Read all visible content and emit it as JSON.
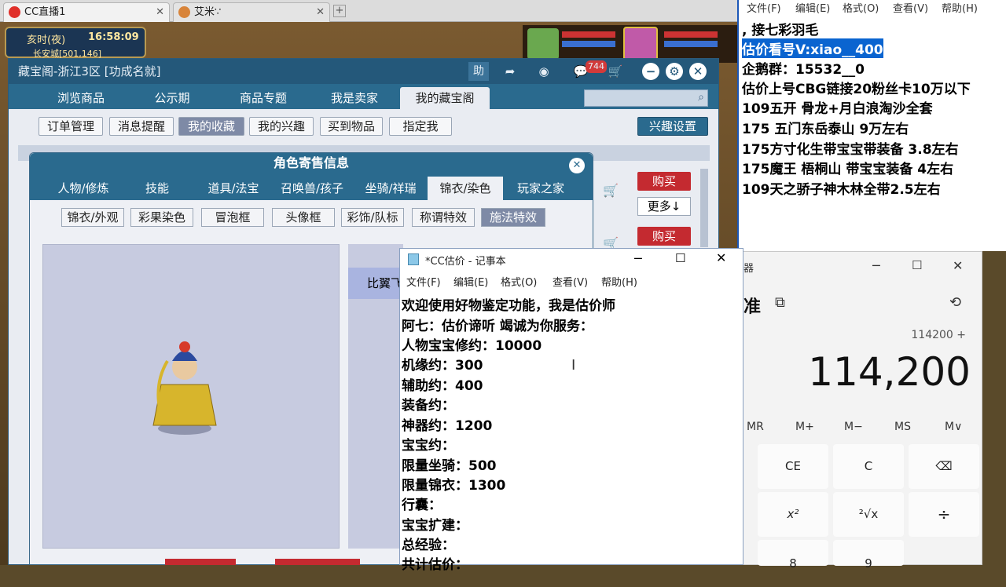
{
  "browser": {
    "tabs": [
      {
        "title": "CC直播1",
        "active": true
      },
      {
        "title": "艾米∵",
        "active": false
      }
    ],
    "new_tab_symbol": "+"
  },
  "game_hud": {
    "time_label": "亥时(夜)",
    "clock": "16:58:09",
    "location": "长安城[501,146]"
  },
  "cbg": {
    "title": "藏宝阁-浙江3区 [功成名就]",
    "header_icons": {
      "help": "助",
      "badge": "744"
    },
    "nav": [
      "浏览商品",
      "公示期",
      "商品专题",
      "我是卖家",
      "我的藏宝阁"
    ],
    "nav_active": 4,
    "subnav": [
      "订单管理",
      "消息提醒",
      "我的收藏",
      "我的兴趣",
      "买到物品",
      "指定我"
    ],
    "subnav_active": 2,
    "interest_button": "兴趣设置",
    "buy_label": "购买",
    "more_label": "更多↓"
  },
  "role_dialog": {
    "title": "角色寄售信息",
    "tabs": [
      "人物/修炼",
      "技能",
      "道具/法宝",
      "召唤兽/孩子",
      "坐骑/祥瑞",
      "锦衣/染色",
      "玩家之家"
    ],
    "tabs_active": 5,
    "subtabs": [
      "锦衣/外观",
      "彩果染色",
      "冒泡框",
      "头像框",
      "彩饰/队标",
      "称谓特效",
      "施法特效"
    ],
    "subtabs_active": 6,
    "compare_label": "比翼飞"
  },
  "notepad_top": {
    "menu": [
      "文件(F)",
      "编辑(E)",
      "格式(O)",
      "查看(V)",
      "帮助(H)"
    ],
    "lines": [
      ",     接七彩羽毛",
      "估价看号V:xiao__400",
      "企鹅群：15532__0",
      "估价上号CBG链接20粉丝卡10万以下",
      "109五开 骨龙+月白浪淘沙全套",
      "175 五门东岳泰山  9万左右",
      "175方寸化生带宝宝带装备  3.8左右",
      "175魔王 梧桐山  带宝宝装备 4左右",
      "109天之骄子神木林全带2.5左右"
    ],
    "highlight_line": 1
  },
  "notepad_main": {
    "title": "*CC估价 - 记事本",
    "menu": [
      "文件(F)",
      "编辑(E)",
      "格式(O)",
      "查看(V)",
      "帮助(H)"
    ],
    "lines": [
      "欢迎使用好物鉴定功能，我是估价师",
      "阿七：估价谛听 竭诚为你服务：",
      "人物宝宝修约：10000",
      "机缘约：300",
      "辅助约：400",
      "装备约：",
      "神器约：1200",
      "宝宝约：",
      "限量坐骑：500",
      "限量锦衣：1300",
      "行囊：",
      "宝宝扩建：",
      "总经验：",
      "共计估价："
    ]
  },
  "calculator": {
    "mode": "准",
    "expression": "114200 +",
    "display": "114,200",
    "memory": [
      "MR",
      "M+",
      "M−",
      "MS",
      "M∨"
    ],
    "keys_row1": [
      "CE",
      "C",
      "⌫"
    ],
    "keys_row2": [
      "x²",
      "²√x",
      "÷"
    ],
    "keys_row3": [
      "8",
      "9"
    ]
  }
}
